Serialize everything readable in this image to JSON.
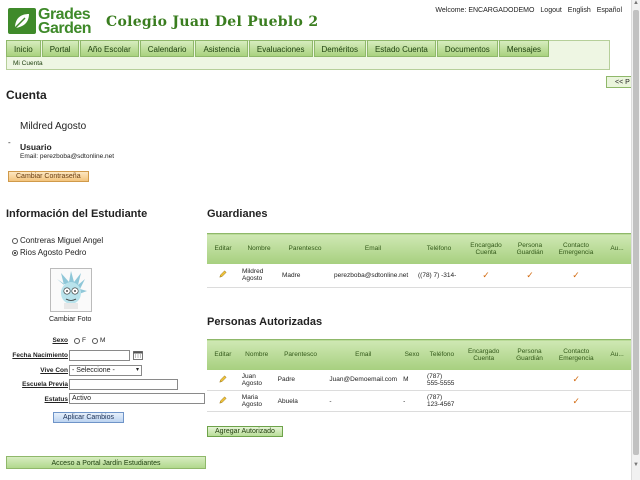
{
  "header": {
    "logo_line1": "Grades",
    "logo_line2": "Garden",
    "school": "Colegio Juan Del Pueblo 2",
    "welcome": "Welcome: ENCARGADODEMO",
    "logout": "Logout",
    "english": "English",
    "spanish": "Español"
  },
  "nav": {
    "items": [
      "Inicio",
      "Portal",
      "Año Escolar",
      "Calendario",
      "Asistencia",
      "Evaluaciones",
      "Deméritos",
      "Estado Cuenta",
      "Documentos",
      "Mensajes"
    ],
    "sub": "Mi Cuenta",
    "back": "<< P"
  },
  "account": {
    "title": "Cuenta",
    "name": "Mildred Agosto",
    "dash": "-",
    "role": "Usuario",
    "email": "Email: perezboba@sdtonline.net",
    "change_password": "Cambiar Contraseña"
  },
  "student": {
    "title": "Información del Estudiante",
    "options": [
      {
        "name": "Contreras Miguel Angel",
        "selected": false
      },
      {
        "name": "Rios Agosto Pedro",
        "selected": true
      }
    ],
    "change_photo": "Cambiar Foto",
    "sexo_label": "Sexo",
    "sexo_f": "F",
    "sexo_m": "M",
    "birth_label": "Fecha Nacimiento",
    "birth_value": "",
    "lives_label": "Vive Con",
    "lives_value": "- Seleccione -",
    "school_label": "Escuela Previa",
    "school_value": "",
    "status_label": "Estatus",
    "status_value": "Activo",
    "apply": "Aplicar Cambios",
    "portal": "Acceso a Portal Jardín Estudiantes"
  },
  "guardians": {
    "title": "Guardianes",
    "columns": [
      "Editar",
      "Nombre",
      "Parentesco",
      "Email",
      "Teléfono",
      "Encargado Cuenta",
      "Persona Guardián",
      "Contacto Emergencia",
      "Au..."
    ],
    "rows": [
      {
        "name": "Mildred Agosto",
        "relation": "Madre",
        "email": "perezboba@sdtonline.net",
        "phone": "((78) 7) -314-",
        "encargado": true,
        "guardian": true,
        "emergency": true
      }
    ]
  },
  "authorized": {
    "title": "Personas Autorizadas",
    "columns": [
      "Editar",
      "Nombre",
      "Parentesco",
      "Email",
      "Sexo",
      "Teléfono",
      "Encargado Cuenta",
      "Persona Guardián",
      "Contacto Emergencia",
      "Au..."
    ],
    "rows": [
      {
        "name": "Juan Agosto",
        "relation": "Padre",
        "email": "Juan@Demoemail.com",
        "sex": "M",
        "phone": "(787) 555-5555",
        "emergency": true
      },
      {
        "name": "Maria Agosto",
        "relation": "Abuela",
        "email": "-",
        "sex": "-",
        "phone": "(787) 123-4567",
        "emergency": true
      }
    ],
    "add": "Agregar Autorizado"
  },
  "colors": {
    "brand": "#3f8a2a",
    "nav": "#a9d27f",
    "check": "#d26a10"
  }
}
